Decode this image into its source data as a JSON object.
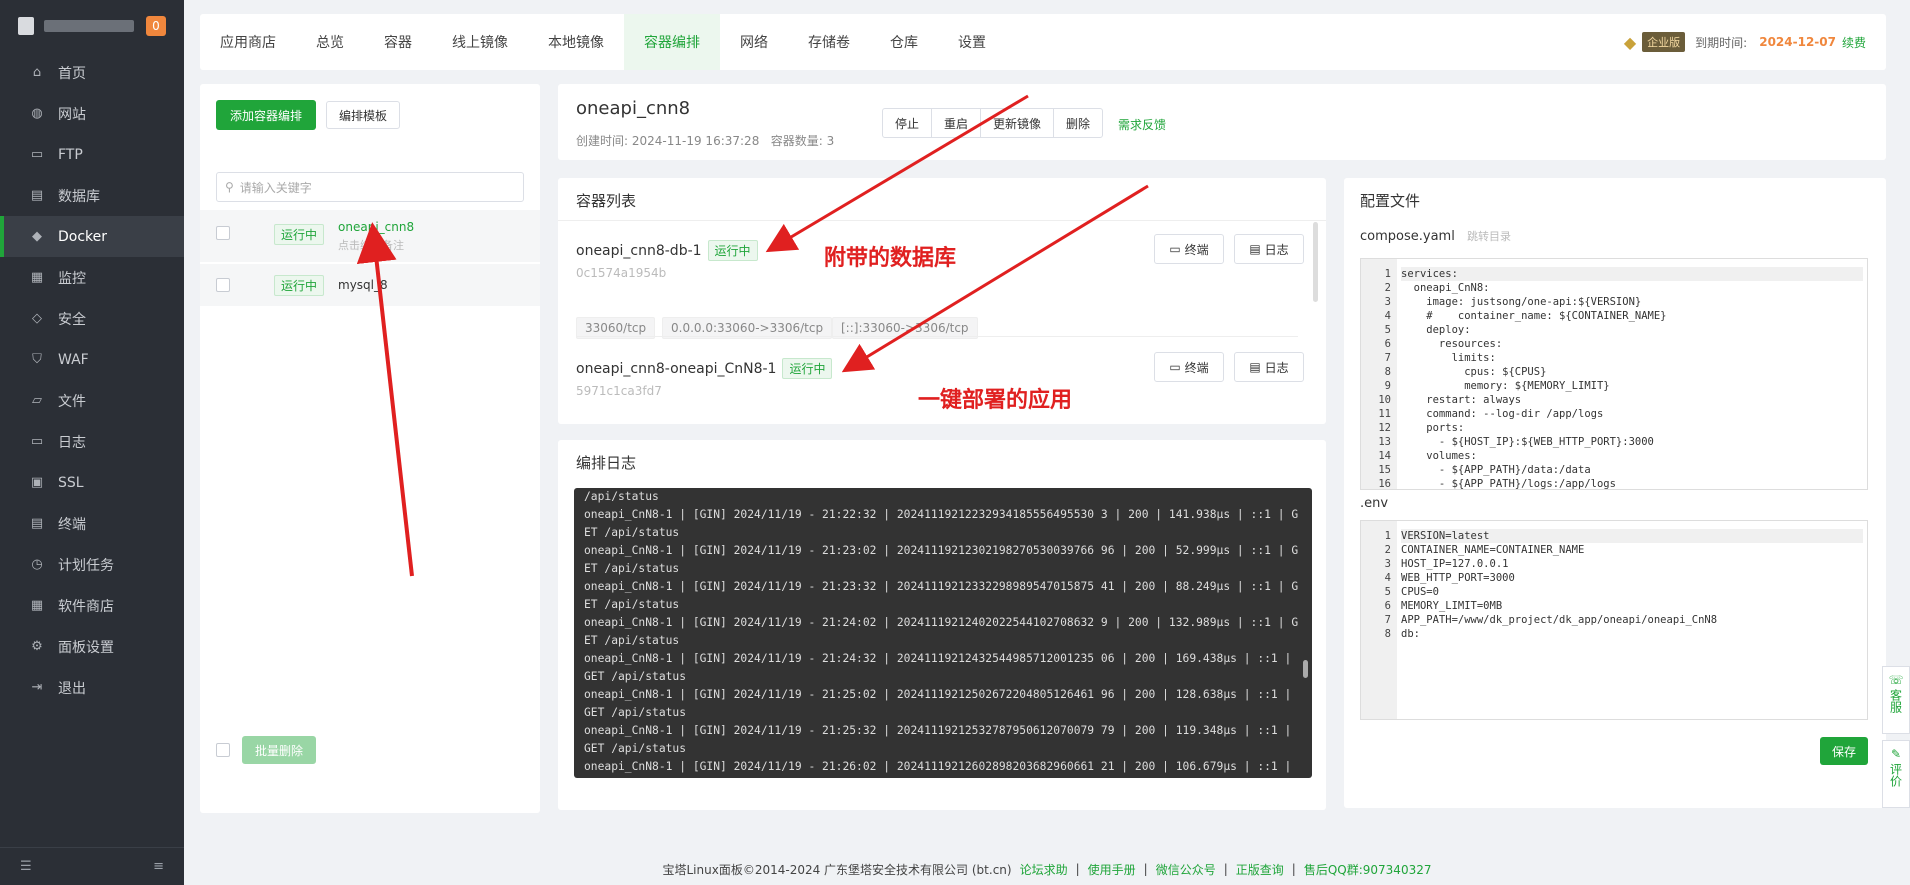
{
  "sidebar": {
    "badge": "0",
    "items": [
      {
        "label": "首页",
        "icon": "⌂"
      },
      {
        "label": "网站",
        "icon": "◍"
      },
      {
        "label": "FTP",
        "icon": "▭"
      },
      {
        "label": "数据库",
        "icon": "▤"
      },
      {
        "label": "Docker",
        "icon": "◆"
      },
      {
        "label": "监控",
        "icon": "▦"
      },
      {
        "label": "安全",
        "icon": "◇"
      },
      {
        "label": "WAF",
        "icon": "⛉"
      },
      {
        "label": "文件",
        "icon": "▱"
      },
      {
        "label": "日志",
        "icon": "▭"
      },
      {
        "label": "SSL",
        "icon": "▣"
      },
      {
        "label": "终端",
        "icon": "▤"
      },
      {
        "label": "计划任务",
        "icon": "◷"
      },
      {
        "label": "软件商店",
        "icon": "▦"
      },
      {
        "label": "面板设置",
        "icon": "⚙"
      },
      {
        "label": "退出",
        "icon": "⇥"
      }
    ]
  },
  "topnav": {
    "tabs": [
      "应用商店",
      "总览",
      "容器",
      "线上镜像",
      "本地镜像",
      "容器编排",
      "网络",
      "存储卷",
      "仓库",
      "设置"
    ],
    "enterprise_label": "企业版",
    "expire_label": "到期时间:",
    "expire_date": "2024-12-07",
    "renew": "续费"
  },
  "left": {
    "add_button": "添加容器编排",
    "template_button": "编排模板",
    "search_placeholder": "请输入关键字",
    "stacks": [
      {
        "status": "运行中",
        "name": "oneapi_cnn8",
        "note": "点击编辑备注"
      },
      {
        "status": "运行中",
        "name": "mysql_8",
        "note": ""
      }
    ],
    "batch_delete": "批量删除"
  },
  "detail": {
    "title": "oneapi_cnn8",
    "created_label": "创建时间:",
    "created": "2024-11-19 16:37:28",
    "count_label": "容器数量:",
    "count": "3",
    "buttons": [
      "停止",
      "重启",
      "更新镜像",
      "删除"
    ],
    "feedback": "需求反馈"
  },
  "containers": {
    "title": "容器列表",
    "terminal_label": "终端",
    "log_label": "日志",
    "items": [
      {
        "name": "oneapi_cnn8-db-1",
        "status": "运行中",
        "id": "0c1574a1954b",
        "ports": [
          "33060/tcp",
          "0.0.0.0:33060->3306/tcp",
          "[::]:33060->3306/tcp"
        ]
      },
      {
        "name": "oneapi_cnn8-oneapi_CnN8-1",
        "status": "运行中",
        "id": "5971c1ca3fd7",
        "ports": []
      }
    ]
  },
  "logs": {
    "title": "编排日志",
    "lines": [
      "/api/status",
      "oneapi_CnN8-1 | [GIN] 2024/11/19 - 21:22:32 | 20241119212232934185556495530 3 | 200 | 141.938µs | ::1 | GET /api/status",
      "oneapi_CnN8-1 | [GIN] 2024/11/19 - 21:23:02 | 20241119212302198270530039766 96 | 200 | 52.999µs | ::1 | GET /api/status",
      "oneapi_CnN8-1 | [GIN] 2024/11/19 - 21:23:32 | 20241119212332298989547015875 41 | 200 | 88.249µs | ::1 | GET /api/status",
      "oneapi_CnN8-1 | [GIN] 2024/11/19 - 21:24:02 | 20241119212402022544102708632 9 | 200 | 132.989µs | ::1 | GET /api/status",
      "oneapi_CnN8-1 | [GIN] 2024/11/19 - 21:24:32 | 20241119212432544985712001235 06 | 200 | 169.438µs | ::1 | GET /api/status",
      "oneapi_CnN8-1 | [GIN] 2024/11/19 - 21:25:02 | 20241119212502672204805126461 96 | 200 | 128.638µs | ::1 | GET /api/status",
      "oneapi_CnN8-1 | [GIN] 2024/11/19 - 21:25:32 | 20241119212532787950612070079 79 | 200 | 119.348µs | ::1 | GET /api/status",
      "oneapi_CnN8-1 | [GIN] 2024/11/19 - 21:26:02 | 20241119212602898203682960661 21 | 200 | 106.679µs | ::1 |"
    ]
  },
  "config": {
    "title": "配置文件",
    "compose_label": "compose.yaml",
    "compose_dir": "跳转目录",
    "compose_lines": [
      "services:",
      "  oneapi_CnN8:",
      "    image: justsong/one-api:${VERSION}",
      "    #    container_name: ${CONTAINER_NAME}",
      "    deploy:",
      "      resources:",
      "        limits:",
      "          cpus: ${CPUS}",
      "          memory: ${MEMORY_LIMIT}",
      "    restart: always",
      "    command: --log-dir /app/logs",
      "    ports:",
      "      - ${HOST_IP}:${WEB_HTTP_PORT}:3000",
      "    volumes:",
      "      - ${APP_PATH}/data:/data",
      "      - ${APP_PATH}/logs:/app/logs"
    ],
    "env_label": ".env",
    "env_lines": [
      "VERSION=latest",
      "CONTAINER_NAME=CONTAINER_NAME",
      "HOST_IP=127.0.0.1",
      "WEB_HTTP_PORT=3000",
      "CPUS=0",
      "MEMORY_LIMIT=0MB",
      "APP_PATH=/www/dk_project/dk_app/oneapi/oneapi_CnN8",
      "db:"
    ],
    "save": "保存"
  },
  "float": {
    "service": "客服",
    "review": "评价"
  },
  "annotations": {
    "db": "附带的数据库",
    "app": "一键部署的应用"
  },
  "footer": {
    "copyright": "宝塔Linux面板©2014-2024 广东堡塔安全技术有限公司 (bt.cn)",
    "links": [
      "论坛求助",
      "使用手册",
      "微信公众号",
      "正版查询"
    ],
    "qq_label": "售后QQ群:",
    "qq": "907340327"
  }
}
